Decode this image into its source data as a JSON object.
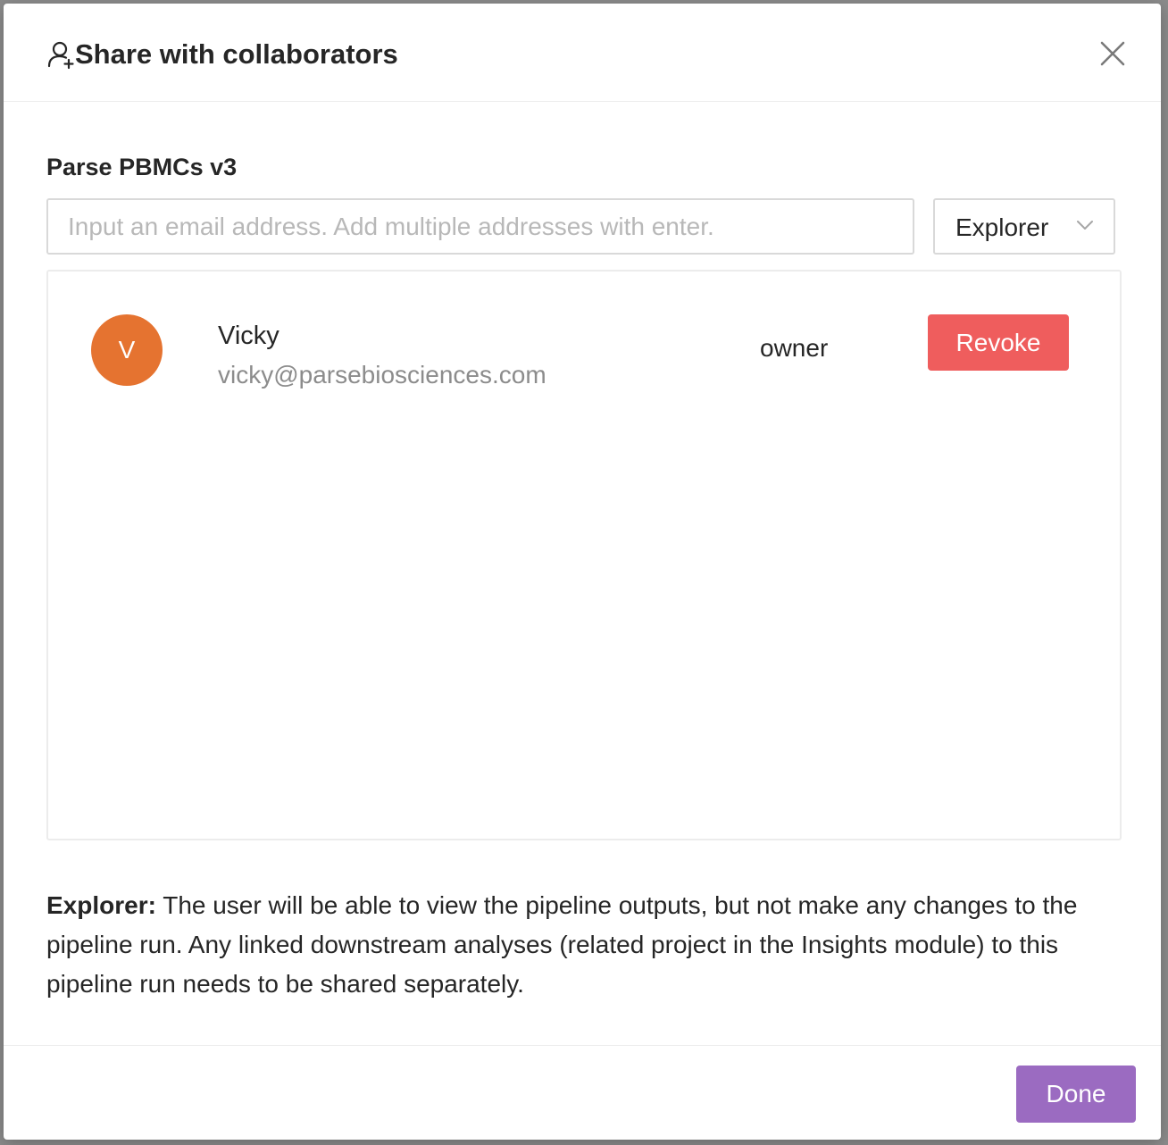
{
  "modal": {
    "title": "Share with collaborators",
    "header_icon": "user-add-icon",
    "close_icon": "close-icon"
  },
  "project": {
    "name": "Parse PBMCs v3"
  },
  "invite": {
    "email_placeholder": "Input an email address. Add multiple addresses with enter.",
    "email_value": "",
    "role_selected": "Explorer",
    "role_chevron_icon": "chevron-down-icon"
  },
  "collaborators": [
    {
      "avatar_initial": "V",
      "avatar_color": "#e57330",
      "name": "Vicky",
      "email": "vicky@parsebiosciences.com",
      "role": "owner",
      "action_label": "Revoke"
    }
  ],
  "role_description": {
    "role": "Explorer:",
    "text": " The user will be able to view the pipeline outputs, but not make any changes to the pipeline run. Any linked downstream analyses (related project in the Insights module) to this pipeline run needs to be shared separately."
  },
  "footer": {
    "done_label": "Done"
  },
  "colors": {
    "revoke": "#ef5d5d",
    "done": "#9b6bc1",
    "avatar": "#e57330"
  }
}
